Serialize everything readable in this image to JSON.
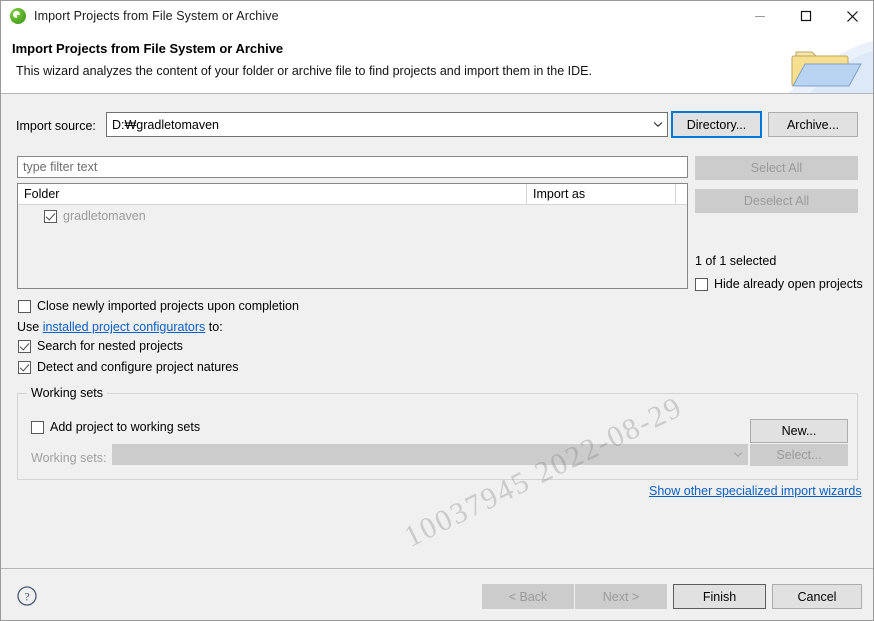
{
  "window": {
    "title": "Import Projects from File System or Archive",
    "app_icon": "eclipse-icon",
    "controls": {
      "minimize": "minimize-icon",
      "maximize": "maximize-icon",
      "close": "close-icon"
    }
  },
  "banner": {
    "title": "Import Projects from File System or Archive",
    "description": "This wizard analyzes the content of your folder or archive file to find projects and import them in the IDE.",
    "icon": "open-folder-icon"
  },
  "source": {
    "label": "Import source:",
    "value": "D:₩gradletomaven",
    "directory_button": "Directory...",
    "archive_button": "Archive..."
  },
  "filter": {
    "placeholder": "type filter text",
    "value": ""
  },
  "tree": {
    "columns": [
      "Folder",
      "Import as",
      ""
    ],
    "rows": [
      {
        "checked": true,
        "folder": "gradletomaven",
        "import_as": ""
      }
    ]
  },
  "selection_panel": {
    "select_all": "Select All",
    "deselect_all": "Deselect All",
    "status": "1 of 1 selected",
    "hide_open_label": "Hide already open projects",
    "hide_open_checked": false
  },
  "options": {
    "close_imported": {
      "label": "Close newly imported projects upon completion",
      "checked": false
    },
    "use_prefix": "Use ",
    "configurators_link": "installed project configurators",
    "use_suffix": " to:",
    "search_nested": {
      "label": "Search for nested projects",
      "checked": true
    },
    "detect_natures": {
      "label": "Detect and configure project natures",
      "checked": true
    }
  },
  "working_sets": {
    "legend": "Working sets",
    "add_label": "Add project to working sets",
    "add_checked": false,
    "new_button": "New...",
    "sets_label": "Working sets:",
    "sets_value": "",
    "select_button": "Select..."
  },
  "other_wizards_link": "Show other specialized import wizards",
  "watermark": "10037945  2022-08-29",
  "footer": {
    "help": "help-icon",
    "back": "< Back",
    "next": "Next >",
    "finish": "Finish",
    "cancel": "Cancel"
  },
  "colors": {
    "accent": "#0078d7",
    "link": "#0d5ec4",
    "dialog_bg": "#f0f0f0",
    "white": "#ffffff"
  }
}
